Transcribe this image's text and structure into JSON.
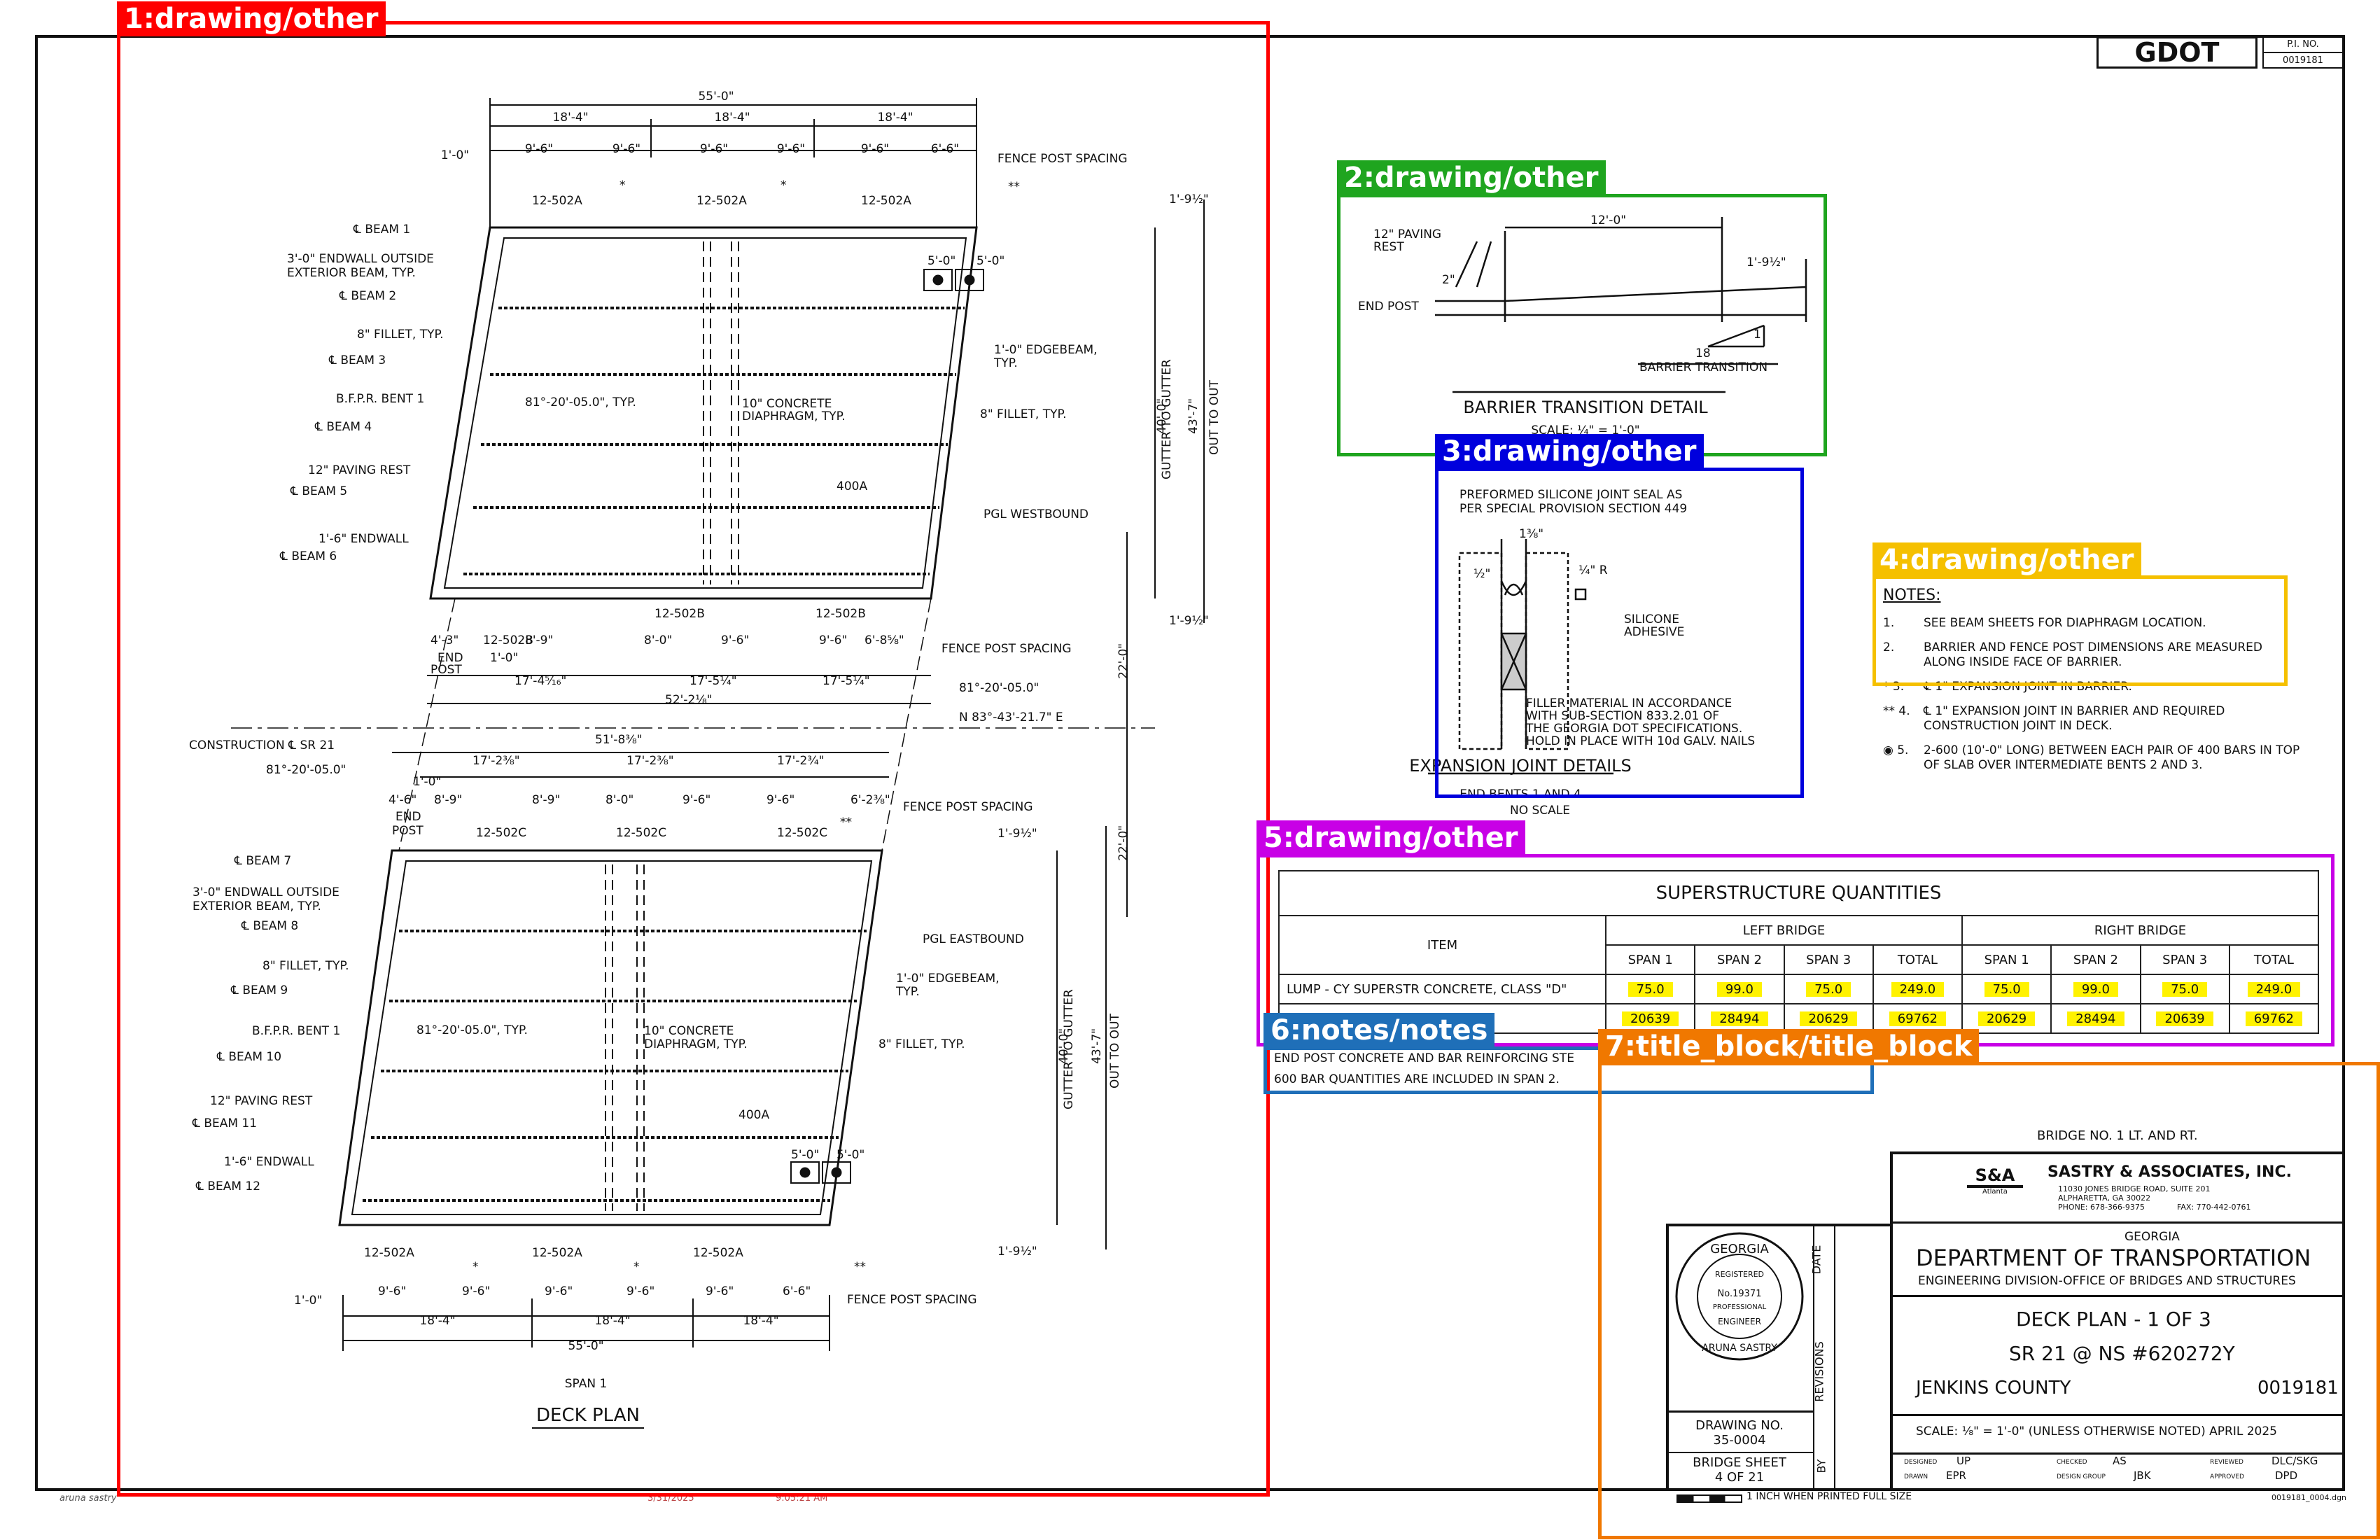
{
  "header": {
    "logo_text": "GDOT",
    "pi_label": "P.I. NO.",
    "pi_value": "0019181"
  },
  "regions": [
    {
      "label": "1:drawing/other",
      "color": "#ff0000"
    },
    {
      "label": "2:drawing/other",
      "color": "#1fa51f"
    },
    {
      "label": "3:drawing/other",
      "color": "#0000dd"
    },
    {
      "label": "4:drawing/other",
      "color": "#f5c000"
    },
    {
      "label": "5:drawing/other",
      "color": "#c800e6"
    },
    {
      "label": "6:notes/notes",
      "color": "#1f6fb8"
    },
    {
      "label": "7:title_block/title_block",
      "color": "#f07800"
    }
  ],
  "deck_plan": {
    "title": "DECK PLAN",
    "span_label": "SPAN 1",
    "overall_dim": "55'-0\"",
    "span_dims": [
      "18'-4\"",
      "18'-4\"",
      "18'-4\""
    ],
    "post_dims": [
      "1'-0\"",
      "9'-6\"",
      "9'-6\"",
      "9'-6\"",
      "9'-6\"",
      "9'-6\"",
      "6'-6\""
    ],
    "fence_post_spacing": "FENCE POST SPACING",
    "joint_marks": [
      "12-502A",
      "12-502A",
      "12-502A"
    ],
    "joint_marks_b": [
      "12-502B",
      "12-502B",
      "12-502B"
    ],
    "joint_marks_c": [
      "12-502C",
      "12-502C",
      "12-502C"
    ],
    "left_labels": [
      "℄ BEAM 1",
      "3'-0\" ENDWALL OUTSIDE",
      "EXTERIOR BEAM, TYP.",
      "℄ BEAM 2",
      "8\" FILLET, TYP.",
      "℄ BEAM 3",
      "B.F.P.R. BENT 1",
      "℄ BEAM 4",
      "12\" PAVING REST",
      "℄ BEAM 5",
      "1'-6\" ENDWALL",
      "℄ BEAM 6"
    ],
    "left_labels_lower": [
      "℄ BEAM 7",
      "3'-0\" ENDWALL OUTSIDE",
      "EXTERIOR BEAM, TYP.",
      "℄ BEAM 8",
      "8\" FILLET, TYP.",
      "℄ BEAM 9",
      "B.F.P.R. BENT 1",
      "℄ BEAM 10",
      "12\" PAVING REST",
      "℄ BEAM 11",
      "1'-6\" ENDWALL",
      "℄ BEAM 12"
    ],
    "inner_labels": [
      "81°-20'-05.0\", TYP.",
      "10\" CONCRETE",
      "DIAPHRAGM, TYP.",
      "400A",
      "1'-0\" EDGEBEAM,",
      "TYP.",
      "8\" FILLET, TYP.",
      "PGL WESTBOUND",
      "PGL EASTBOUND"
    ],
    "right_dims": [
      "1'-9½\"",
      "40'-0\"",
      "GUTTER TO GUTTER",
      "43'-7\"",
      "OUT TO OUT",
      "22'-0\"",
      "1'-9½\""
    ],
    "mid_dims": [
      "4'-3\"",
      "END",
      "POST",
      "1'-0\"",
      "8'-9\"",
      "8'-0\"",
      "9'-6\"",
      "9'-6\"",
      "6'-8⅝\"",
      "17'-4⁵⁄₁₆\"",
      "17'-5¼\"",
      "17'-5¼\"",
      "52'-2⅛\"",
      "81°-20'-05.0\"",
      "N 83°-43'-21.7\" E",
      "CONSTRUCTION ℄ SR 21",
      "81°-20'-05.0\""
    ],
    "mid_dims_lower": [
      "51'-8⅜\"",
      "17'-2⅜\"",
      "17'-2⅜\"",
      "17'-2¾\"",
      "1'-0\"",
      "4'-6\"",
      "8'-9\"",
      "8'-9\"",
      "8'-0\"",
      "9'-6\"",
      "9'-6\"",
      "6'-2⅜\""
    ],
    "five_ft": "5'-0\"",
    "star": "*",
    "dstar": "**"
  },
  "barrier": {
    "title": "BARRIER TRANSITION DETAIL",
    "scale": "SCALE: ¼\" = 1'-0\"",
    "labels": [
      "12\" PAVING",
      "REST",
      "END POST",
      "2\"",
      "12'-0\"",
      "1'-9½\"",
      "18",
      "1",
      "BARRIER TRANSITION"
    ]
  },
  "expansion": {
    "title": "EXPANSION JOINT DETAILS",
    "subtitle": "END BENTS 1 AND 4",
    "scale": "NO SCALE",
    "note1": [
      "PREFORMED SILICONE JOINT SEAL AS",
      "PER SPECIAL PROVISION SECTION 449"
    ],
    "dims": [
      "1⅜\"",
      "½\"",
      "¼\" R"
    ],
    "silicone": [
      "SILICONE",
      "ADHESIVE"
    ],
    "filler": [
      "FILLER MATERIAL IN ACCORDANCE",
      "WITH SUB-SECTION 833.2.01 OF",
      "THE GEORGIA DOT SPECIFICATIONS.",
      "HOLD IN PLACE WITH 10d GALV. NAILS"
    ]
  },
  "notes": {
    "title": "NOTES:",
    "items": [
      {
        "mark": "1.",
        "text": "SEE BEAM SHEETS FOR DIAPHRAGM LOCATION."
      },
      {
        "mark": "2.",
        "text": "BARRIER AND FENCE POST DIMENSIONS ARE MEASURED ALONG INSIDE FACE OF BARRIER."
      },
      {
        "mark": "* 3.",
        "text": "℄ 1\" EXPANSION JOINT IN BARRIER."
      },
      {
        "mark": "** 4.",
        "text": "℄ 1\" EXPANSION JOINT IN BARRIER AND REQUIRED CONSTRUCTION JOINT IN DECK."
      },
      {
        "mark": "◉ 5.",
        "text": "2-600 (10'-0\" LONG) BETWEEN EACH PAIR OF 400 BARS IN TOP OF SLAB OVER INTERMEDIATE BENTS 2 AND 3."
      }
    ]
  },
  "quantities": {
    "title": "SUPERSTRUCTURE QUANTITIES",
    "item_header": "ITEM",
    "left_bridge": "LEFT BRIDGE",
    "right_bridge": "RIGHT BRIDGE",
    "col_headers": [
      "SPAN 1",
      "SPAN 2",
      "SPAN 3",
      "TOTAL",
      "SPAN 1",
      "SPAN 2",
      "SPAN 3",
      "TOTAL"
    ],
    "rows": [
      {
        "item": "LUMP - CY SUPERSTR CONCRETE, CLASS \"D\"",
        "values": [
          "75.0",
          "99.0",
          "75.0",
          "249.0",
          "75.0",
          "99.0",
          "75.0",
          "249.0"
        ]
      },
      {
        "item": "STEEL",
        "values": [
          "20639",
          "28494",
          "20629",
          "69762",
          "20629",
          "28494",
          "20639",
          "69762"
        ]
      }
    ]
  },
  "qty_notes": [
    "END POST CONCRETE AND BAR REINFORCING STE",
    "600 BAR QUANTITIES ARE INCLUDED IN SPAN 2."
  ],
  "title_block": {
    "bridge_no": "BRIDGE NO. 1 LT. AND RT.",
    "firm_logo": "S&A",
    "firm_logo_sub": "Atlanta",
    "firm_name": "SASTRY & ASSOCIATES, INC.",
    "firm_address": [
      "11030 JONES BRIDGE ROAD, SUITE 201",
      "ALPHARETTA, GA 30022",
      "PHONE: 678-366-9375"
    ],
    "firm_fax": "FAX: 770-442-0761",
    "state": "GEORGIA",
    "dept": "DEPARTMENT OF TRANSPORTATION",
    "division": "ENGINEERING DIVISION-OFFICE OF BRIDGES AND STRUCTURES",
    "sheet_title": "DECK PLAN - 1 OF 3",
    "route": "SR 21 @ NS #620272Y",
    "county": "JENKINS COUNTY",
    "project_no": "0019181",
    "scale_date": "SCALE: ⅛\" = 1'-0\" (UNLESS OTHERWISE NOTED)  APRIL 2025",
    "seal_top": "GEORGIA",
    "seal_reg": "REGISTERED",
    "seal_no": "No.19371",
    "seal_prof": "PROFESSIONAL",
    "seal_eng": "ENGINEER",
    "seal_name": "ARUNA SASTRY",
    "date_label": "DATE",
    "revisions_label": "REVISIONS",
    "by_label": "BY",
    "drawing_no_label": "DRAWING NO.",
    "drawing_no": "35-0004",
    "bridge_sheet_label": "BRIDGE SHEET",
    "bridge_sheet": "4  OF  21",
    "designed_label": "DESIGNED",
    "designed": "UP",
    "checked_label": "CHECKED",
    "checked": "AS",
    "reviewed_label": "REVIEWED",
    "reviewed": "DLC/SKG",
    "drawn_label": "DRAWN",
    "drawn": "EPR",
    "design_group_label": "DESIGN GROUP",
    "design_group": "JBK",
    "approved_label": "APPROVED",
    "approved": "DPD",
    "scale_bar_note": "1 INCH WHEN PRINTED FULL SIZE",
    "file_name": "0019181_0004.dgn"
  },
  "footer": {
    "left": "aruna sastry",
    "mid1": "3/31/2025",
    "mid2": "9:05:21 AM"
  }
}
